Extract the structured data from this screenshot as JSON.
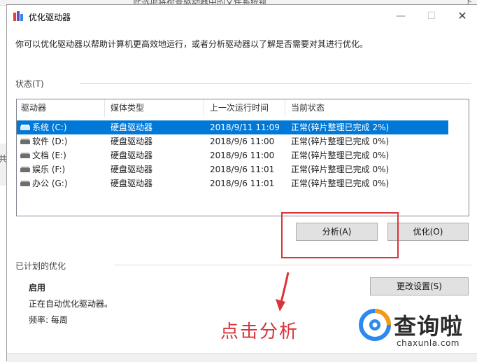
{
  "background_window": {
    "partial_text": "此选项将检查驱动器中的文件系统错误",
    "right_edge_text": "下载",
    "left_edge_text": "共"
  },
  "window": {
    "title": "优化驱动器",
    "intro": "你可以优化驱动器以帮助计算机更高效地运行，或者分析驱动器以了解是否需要对其进行优化。"
  },
  "status": {
    "label": "状态(T)",
    "columns": [
      "驱动器",
      "媒体类型",
      "上一次运行时间",
      "当前状态"
    ],
    "rows": [
      {
        "drive": "系统 (C:)",
        "media": "硬盘驱动器",
        "last_run": "2018/9/11 11:09",
        "state": "正常(碎片整理已完成 2%)",
        "selected": true,
        "icon": "system-drive-icon"
      },
      {
        "drive": "软件 (D:)",
        "media": "硬盘驱动器",
        "last_run": "2018/9/6 11:00",
        "state": "正常(碎片整理已完成 0%)",
        "selected": false,
        "icon": "hard-drive-icon"
      },
      {
        "drive": "文档 (E:)",
        "media": "硬盘驱动器",
        "last_run": "2018/9/6 11:00",
        "state": "正常(碎片整理已完成 0%)",
        "selected": false,
        "icon": "hard-drive-icon"
      },
      {
        "drive": "娱乐 (F:)",
        "media": "硬盘驱动器",
        "last_run": "2018/9/6 11:01",
        "state": "正常(碎片整理已完成 0%)",
        "selected": false,
        "icon": "hard-drive-icon"
      },
      {
        "drive": "办公 (G:)",
        "media": "硬盘驱动器",
        "last_run": "2018/9/6 11:01",
        "state": "正常(碎片整理已完成 0%)",
        "selected": false,
        "icon": "hard-drive-icon"
      }
    ]
  },
  "buttons": {
    "analyze": "分析(A)",
    "optimize": "优化(O)",
    "change_settings": "更改设置(S)"
  },
  "scheduled": {
    "label": "已计划的优化",
    "enabled": "启用",
    "status": "正在自动优化驱动器。",
    "frequency": "频率: 每周"
  },
  "annotation": {
    "text": "点击分析",
    "color": "#d9343a"
  },
  "watermark": {
    "name_cn": "查询啦",
    "domain": "chaxunla.com"
  },
  "colors": {
    "selection": "#0078d7",
    "highlight": "#d9343a"
  }
}
